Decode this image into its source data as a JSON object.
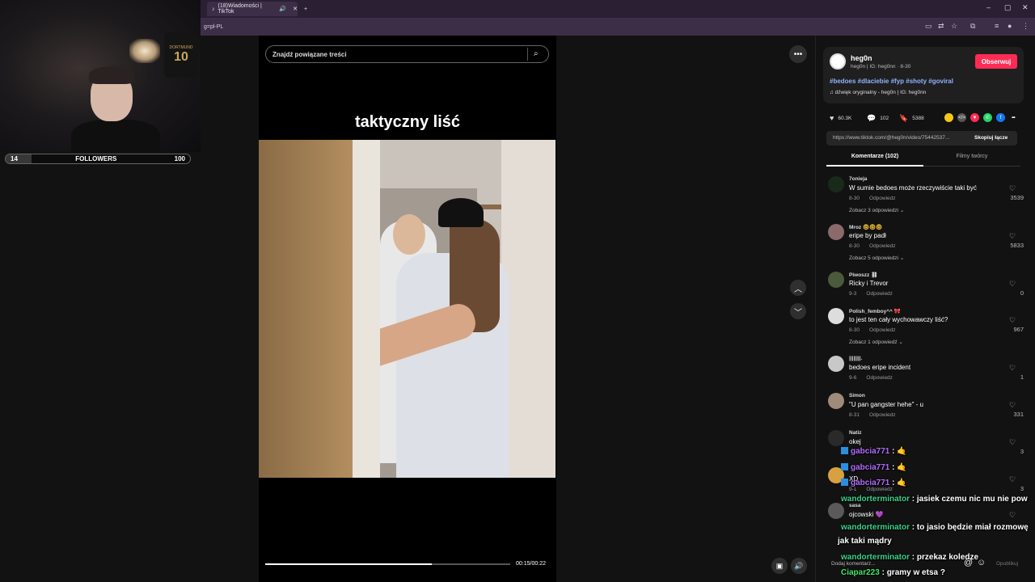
{
  "browser": {
    "tab_title": "(18)Wiadomości | TikTok",
    "tab_mute_icon": "speaker-icon",
    "tab_close": "✕",
    "new_tab": "+",
    "url": "g=pl-PL",
    "window_controls": [
      "–",
      "▢",
      "✕"
    ]
  },
  "webcam": {
    "jersey_number": "10",
    "jersey_name": "DORTMUND",
    "followers_label": "FOLLOWERS",
    "followers_current": "14",
    "followers_goal": "100",
    "followers_progress": 0.14
  },
  "video": {
    "search_placeholder": "Znajdź powiązane treści",
    "overlay_title": "taktyczny liść",
    "time": "00:15/00:22",
    "progress": 0.68
  },
  "author": {
    "name": "heg0n",
    "subtitle": "heg0n | IG: heg0nn · 8-30",
    "follow_label": "Obserwuj",
    "hashtags": "#bedoes #dlaciebie #fyp #shoty #goviral",
    "sound": "♫  dźwięk oryginalny - heg0n | IG: heg0nn"
  },
  "stats": {
    "likes": "60.3K",
    "comments": "102",
    "saves": "5388"
  },
  "share": {
    "url": "https://www.tiktok.com/@heg0n/video/75442537...",
    "copy_label": "Skopiuj łącze",
    "colors": [
      "#f5c518",
      "#555555",
      "#fe2c55",
      "#25d366",
      "#1877f2"
    ]
  },
  "tabs": {
    "comments": "Komentarze (102)",
    "creator_videos": "Filmy twórcy"
  },
  "comments": [
    {
      "user": "7onieja",
      "text": "W sumie bedoes może rzeczywiście taki być",
      "date": "8-30",
      "reply": "Odpowiedz",
      "more": "Zobacz 3 odpowiedzi ⌄",
      "likes": "3539",
      "avatar_color": "#1a2a1a"
    },
    {
      "user": "Mroz 🤓🤓🤓",
      "text": "eripe by padł",
      "date": "8-30",
      "reply": "Odpowiedz",
      "more": "Zobacz 5 odpowiedzi ⌄",
      "likes": "5833",
      "avatar_color": "#8a6a6a"
    },
    {
      "user": "Piwoszz ⛓",
      "text": "Ricky i Trevor",
      "date": "9-3",
      "reply": "Odpowiedz",
      "more": "",
      "likes": "0",
      "avatar_color": "#4a5a3a"
    },
    {
      "user": "Polish_femboy^^ 🎀",
      "text": "to jest ten cały wychowawczy liść?",
      "date": "8-30",
      "reply": "Odpowiedz",
      "more": "Zobacz 1 odpowiedź ⌄",
      "likes": "967",
      "avatar_color": "#dddddd"
    },
    {
      "user": "||||||||.",
      "text": "bedoes eripe incident",
      "date": "9-6",
      "reply": "Odpowiedz",
      "more": "",
      "likes": "1",
      "avatar_color": "#c8c8c8"
    },
    {
      "user": "Simon",
      "text": "\"U pan gangster hehe\" - u",
      "date": "8-31",
      "reply": "Odpowiedz",
      "more": "",
      "likes": "331",
      "avatar_color": "#a08a7a"
    },
    {
      "user": "Natiz",
      "text": "okej",
      "date": "",
      "reply": "",
      "more": "",
      "likes": "3",
      "avatar_color": "#2a2a2a"
    },
    {
      "user": "",
      "text": "XD",
      "date": "9-1",
      "reply": "Odpowiedz",
      "more": "",
      "likes": "3",
      "avatar_color": "#d8a040"
    },
    {
      "user": "sasa",
      "text": "ojcowski 💜",
      "date": "",
      "reply": "",
      "more": "",
      "likes": "",
      "avatar_color": "#5a5a5a"
    }
  ],
  "chat": [
    {
      "user": "gabcia771",
      "msg": "🤙",
      "color": "purple"
    },
    {
      "user": "gabcia771",
      "msg": "🤙",
      "color": "purple"
    },
    {
      "user": "gabcia771",
      "msg": "🤙",
      "color": "purple"
    },
    {
      "user": "wandorterminator",
      "msg": "jasiek czemu nic mu nie pow",
      "color": "green"
    },
    {
      "user": "wandorterminator",
      "msg": "to jasio będzie miał rozmowę",
      "color": "green"
    },
    {
      "user": "",
      "msg": "jak taki mądry",
      "color": "green"
    },
    {
      "user": "wandorterminator",
      "msg": "przekaz koledze",
      "color": "green"
    },
    {
      "user": "Ciapar223",
      "msg": "gramy w etsa ?",
      "color": "lime"
    }
  ],
  "composer": {
    "placeholder": "Dodaj komentarz...",
    "publish": "Opublikuj"
  }
}
